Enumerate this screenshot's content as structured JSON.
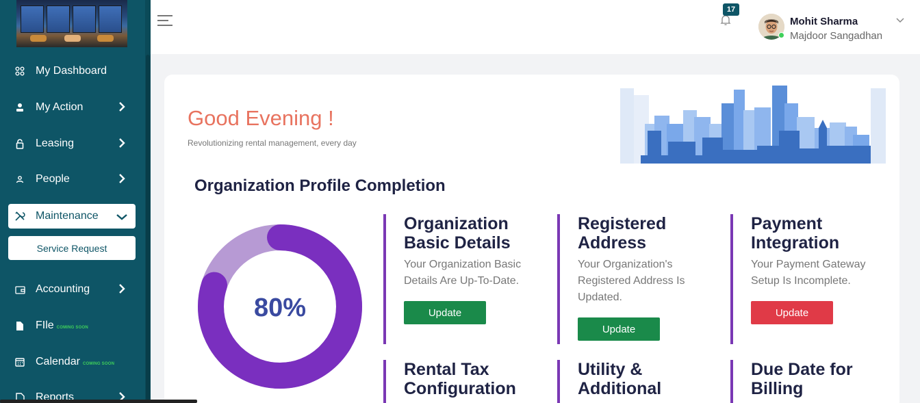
{
  "sidebar": {
    "items": [
      {
        "label": "My Dashboard"
      },
      {
        "label": "My Action"
      },
      {
        "label": "Leasing"
      },
      {
        "label": "People"
      },
      {
        "label": "Maintenance"
      },
      {
        "label": "Accounting"
      },
      {
        "label": "FIle",
        "badge": "COMING SOON"
      },
      {
        "label": "Calendar",
        "badge": "COMING SOON"
      },
      {
        "label": "Reports"
      }
    ],
    "subitem": "Service Request"
  },
  "header": {
    "notification_count": "17",
    "user_name": "Mohit Sharma",
    "user_org": "Majdoor Sangadhan"
  },
  "main": {
    "greeting": "Good Evening !",
    "tagline": "Revolutionizing rental management, every day",
    "section_title": "Organization Profile Completion",
    "completion_label": "80%",
    "completion_value": 80,
    "tasks": [
      {
        "title": "Organization Basic Details",
        "desc": "Your Organization Basic Details Are Up-To-Date.",
        "button": "Update",
        "status": "complete"
      },
      {
        "title": "Registered Address",
        "desc": "Your Organization's Registered Address Is Updated.",
        "button": "Update",
        "status": "complete"
      },
      {
        "title": "Payment Integration",
        "desc": "Your Payment Gateway Setup Is Incomplete.",
        "button": "Update",
        "status": "incomplete"
      },
      {
        "title": "Rental Tax Configuration"
      },
      {
        "title": "Utility & Additional"
      },
      {
        "title": "Due Date for Billing"
      }
    ]
  },
  "colors": {
    "sidebar_bg": "#0e5566",
    "accent_purple": "#7a38b4",
    "donut_light": "#b79ad4",
    "greeting": "#e8735f",
    "success": "#1a8a4a",
    "danger": "#e03a47"
  }
}
